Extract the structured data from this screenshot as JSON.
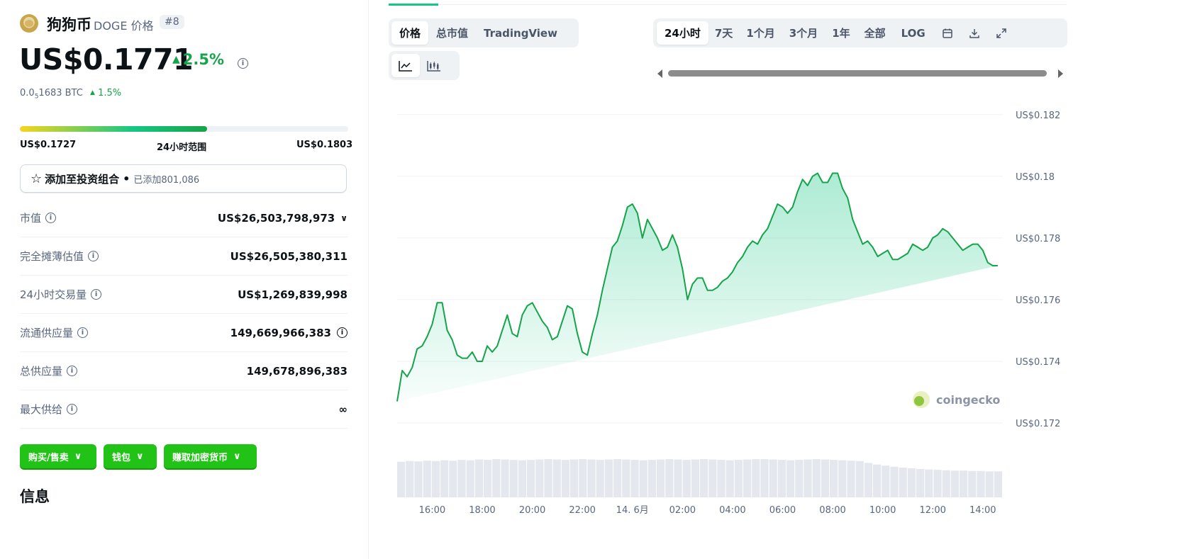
{
  "coin": {
    "name": "狗狗币",
    "subtitle": "DOGE 价格",
    "rank": "#8",
    "price": "US$0.1771",
    "change_24h": "2.5%",
    "btc_price_prefix": "0.0",
    "btc_price_sub": "5",
    "btc_price_rest": "1683 BTC",
    "btc_change": "1.5%"
  },
  "range": {
    "low": "US$0.1727",
    "label": "24小时范围",
    "high": "US$0.1803",
    "position": 0.57
  },
  "portfolio": {
    "label": "添加至投资组合",
    "added": "已添加801,086"
  },
  "stats": [
    {
      "label": "市值",
      "value": "US$26,503,798,973"
    },
    {
      "label": "完全摊薄估值",
      "value": "US$26,505,380,311"
    },
    {
      "label": "24小时交易量",
      "value": "US$1,269,839,998"
    },
    {
      "label": "流通供应量",
      "value": "149,669,966,383"
    },
    {
      "label": "总供应量",
      "value": "149,678,896,383"
    },
    {
      "label": "最大供给",
      "value": "∞"
    }
  ],
  "actions": {
    "buy_sell": "购买/售卖",
    "wallet": "钱包",
    "earn": "赚取加密货币"
  },
  "section_title": "信息",
  "chart_tabs": [
    "价格",
    "总市值",
    "TradingView"
  ],
  "time_tabs": [
    "24小时",
    "7天",
    "1个月",
    "3个月",
    "1年",
    "全部",
    "LOG"
  ],
  "watermark": "coingecko",
  "colors": {
    "green": "#16a34a",
    "button_green": "#22c317",
    "chart_line": "#16a34a"
  },
  "chart_data": {
    "type": "area",
    "y_ticks": [
      "US$0.182",
      "US$0.18",
      "US$0.178",
      "US$0.176",
      "US$0.174",
      "US$0.172"
    ],
    "y_values": [
      0.182,
      0.18,
      0.178,
      0.176,
      0.174,
      0.172
    ],
    "ylim": [
      0.172,
      0.182
    ],
    "x_ticks": [
      "16:00",
      "18:00",
      "20:00",
      "22:00",
      "14. 6月",
      "02:00",
      "04:00",
      "06:00",
      "08:00",
      "10:00",
      "12:00",
      "14:00"
    ],
    "x_tick_hours": [
      16,
      18,
      20,
      22,
      24,
      26,
      28,
      30,
      32,
      34,
      36,
      38
    ],
    "x_range_hours": [
      14.6,
      38.8
    ],
    "grid": true,
    "series": [
      {
        "hours": [
          14.6,
          14.8,
          15.0,
          15.2,
          15.4,
          15.6,
          15.8,
          16.0,
          16.2,
          16.4,
          16.6,
          16.8,
          17.0,
          17.2,
          17.4,
          17.6,
          17.8,
          18.0,
          18.2,
          18.4,
          18.6,
          18.8,
          19.0,
          19.2,
          19.4,
          19.6,
          19.8,
          20.0,
          20.2,
          20.4,
          20.6,
          20.8,
          21.0,
          21.2,
          21.4,
          21.6,
          21.8,
          22.0,
          22.2,
          22.4,
          22.6,
          22.8,
          23.0,
          23.2,
          23.4,
          23.6,
          23.8,
          24.0,
          24.2,
          24.4,
          24.6,
          24.8,
          25.0,
          25.2,
          25.4,
          25.6,
          25.8,
          26.0,
          26.2,
          26.4,
          26.6,
          26.8,
          27.0,
          27.2,
          27.4,
          27.6,
          27.8,
          28.0,
          28.2,
          28.4,
          28.6,
          28.8,
          29.0,
          29.2,
          29.4,
          29.6,
          29.8,
          30.0,
          30.2,
          30.4,
          30.6,
          30.8,
          31.0,
          31.2,
          31.4,
          31.6,
          31.8,
          32.0,
          32.2,
          32.4,
          32.6,
          32.8,
          33.0,
          33.2,
          33.4,
          33.6,
          33.8,
          34.0,
          34.2,
          34.4,
          34.6,
          34.8,
          35.0,
          35.2,
          35.4,
          35.6,
          35.8,
          36.0,
          36.2,
          36.4,
          36.6,
          36.8,
          37.0,
          37.2,
          37.4,
          37.6,
          37.8,
          38.0,
          38.2,
          38.4,
          38.6,
          38.8
        ],
        "values": [
          0.1727,
          0.1737,
          0.1735,
          0.1738,
          0.1744,
          0.1745,
          0.1748,
          0.1752,
          0.1759,
          0.1759,
          0.175,
          0.1747,
          0.1742,
          0.1741,
          0.1741,
          0.1743,
          0.174,
          0.174,
          0.1745,
          0.1743,
          0.1745,
          0.175,
          0.1755,
          0.1749,
          0.1748,
          0.1755,
          0.1758,
          0.1759,
          0.1756,
          0.1753,
          0.1751,
          0.1747,
          0.1748,
          0.1753,
          0.1758,
          0.1757,
          0.1749,
          0.1743,
          0.1742,
          0.1749,
          0.1755,
          0.1763,
          0.177,
          0.1777,
          0.1779,
          0.1784,
          0.179,
          0.1791,
          0.1788,
          0.178,
          0.1786,
          0.1783,
          0.178,
          0.1776,
          0.1777,
          0.1781,
          0.1777,
          0.177,
          0.176,
          0.1765,
          0.1767,
          0.1767,
          0.1763,
          0.1763,
          0.1764,
          0.1766,
          0.1767,
          0.1769,
          0.1772,
          0.1774,
          0.1777,
          0.1779,
          0.1778,
          0.1781,
          0.1783,
          0.1787,
          0.1791,
          0.179,
          0.1788,
          0.179,
          0.1795,
          0.1799,
          0.1797,
          0.18,
          0.1801,
          0.1798,
          0.1798,
          0.1801,
          0.1801,
          0.1796,
          0.1793,
          0.1786,
          0.1782,
          0.1778,
          0.1779,
          0.1777,
          0.1774,
          0.1775,
          0.1776,
          0.1773,
          0.1773,
          0.1774,
          0.1775,
          0.1778,
          0.1777,
          0.1776,
          0.1777,
          0.178,
          0.1781,
          0.1783,
          0.1782,
          0.178,
          0.1778,
          0.1776,
          0.1777,
          0.1778,
          0.1778,
          0.1776,
          0.1772,
          0.1771,
          0.1771
        ]
      }
    ],
    "volume_relative": [
      0.93,
      0.95,
      0.94,
      0.96,
      0.95,
      0.97,
      0.96,
      0.98,
      0.97,
      0.99,
      0.98,
      1.0,
      0.99,
      0.98,
      0.97,
      0.98,
      0.99,
      1.0,
      0.99,
      0.98,
      0.99,
      1.0,
      0.99,
      0.98,
      0.99,
      1.0,
      0.99,
      0.98,
      0.97,
      0.98,
      0.99,
      1.0,
      0.99,
      0.98,
      0.99,
      1.0,
      0.99,
      0.98,
      0.97,
      0.98,
      0.99,
      1.0,
      1.0,
      0.99,
      0.98,
      0.97,
      0.98,
      0.99,
      1.0,
      0.99,
      0.98,
      0.97,
      0.96,
      0.95,
      0.9,
      0.86,
      0.83,
      0.8,
      0.78,
      0.76,
      0.74,
      0.73,
      0.72,
      0.71,
      0.7,
      0.7,
      0.69,
      0.69,
      0.68,
      0.68
    ]
  }
}
